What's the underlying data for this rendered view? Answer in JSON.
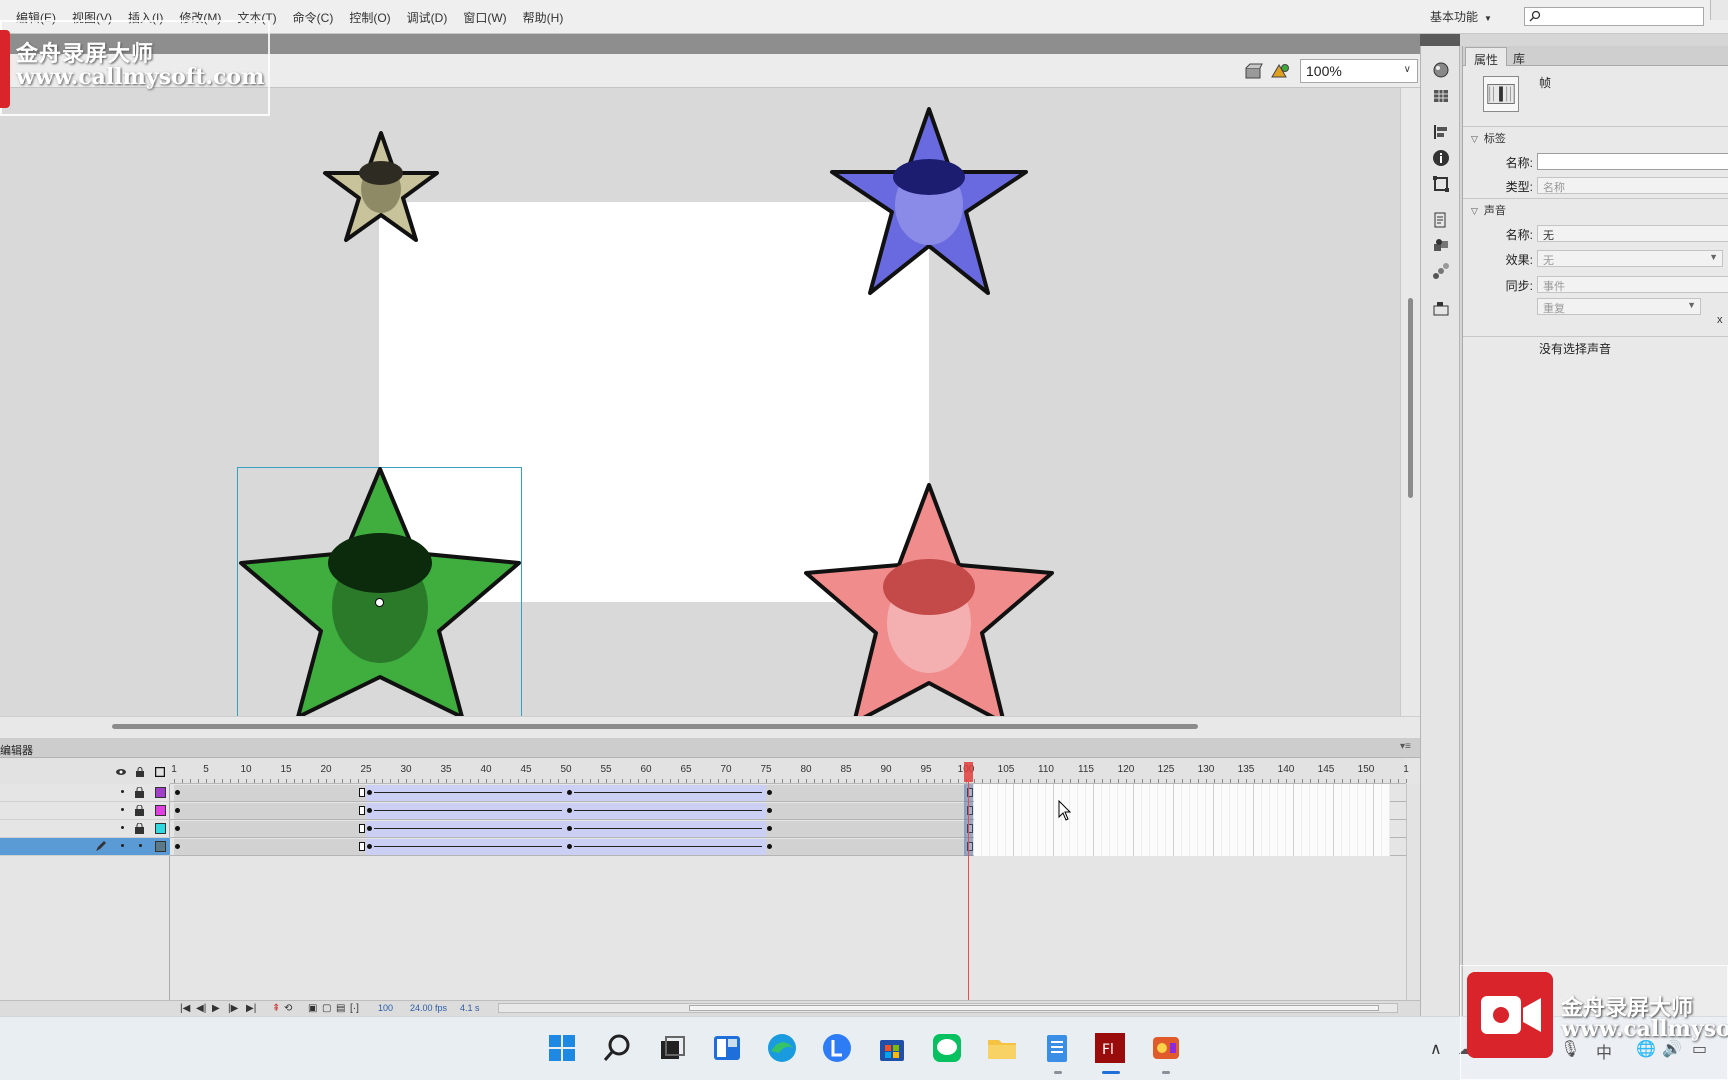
{
  "menu": {
    "items": [
      "编辑(E)",
      "视图(V)",
      "插入(I)",
      "修改(M)",
      "文本(T)",
      "命令(C)",
      "控制(O)",
      "调试(D)",
      "窗口(W)",
      "帮助(H)"
    ],
    "workspace": "基本功能",
    "search_value": ""
  },
  "edit_bar": {
    "zoom": "100%"
  },
  "watermark": {
    "brand": "金舟录屏大师",
    "url_top": "www.callmysoft.com",
    "url_bottom": "www.callmyso"
  },
  "properties": {
    "tabs": [
      "属性",
      "库"
    ],
    "frame_label": "帧",
    "label_section": "标签",
    "name_label": "名称:",
    "name_value": "",
    "type_label": "类型:",
    "type_value": "名称",
    "sound_section": "声音",
    "sound_name_label": "名称:",
    "sound_name_value": "无",
    "effect_label": "效果:",
    "effect_value": "无",
    "sync_label": "同步:",
    "sync_value": "事件",
    "repeat_value": "重复",
    "repeat_close": "x",
    "no_sound_text": "没有选择声音"
  },
  "timeline": {
    "title": "编辑器",
    "ruler_numbers": [
      "1",
      "5",
      "10",
      "15",
      "20",
      "25",
      "30",
      "35",
      "40",
      "45",
      "50",
      "55",
      "60",
      "65",
      "70",
      "75",
      "80",
      "85",
      "90",
      "95",
      "100",
      "105",
      "110",
      "115",
      "120",
      "125",
      "130",
      "135",
      "140",
      "145",
      "150",
      "1"
    ],
    "layer_colors": [
      "#a040c8",
      "#e040e0",
      "#30d8e0",
      "#5a7a8a"
    ],
    "current_frame": "100",
    "fps": "24.00 fps",
    "time": "4.1 s"
  },
  "taskbar": {
    "apps": [
      "windows-start",
      "search",
      "task-view",
      "widgets",
      "edge",
      "app-l",
      "store",
      "wechat",
      "explorer",
      "notepad",
      "flash",
      "recorder"
    ],
    "ime": "中"
  },
  "colors": {
    "star_tan": "#c8c39a",
    "star_blue": "#6a6ae0",
    "star_green": "#3fae3f",
    "star_red": "#f08c8c",
    "selection": "#3a9fbf",
    "tween": "#cccff4",
    "playhead": "#e23d3d"
  }
}
